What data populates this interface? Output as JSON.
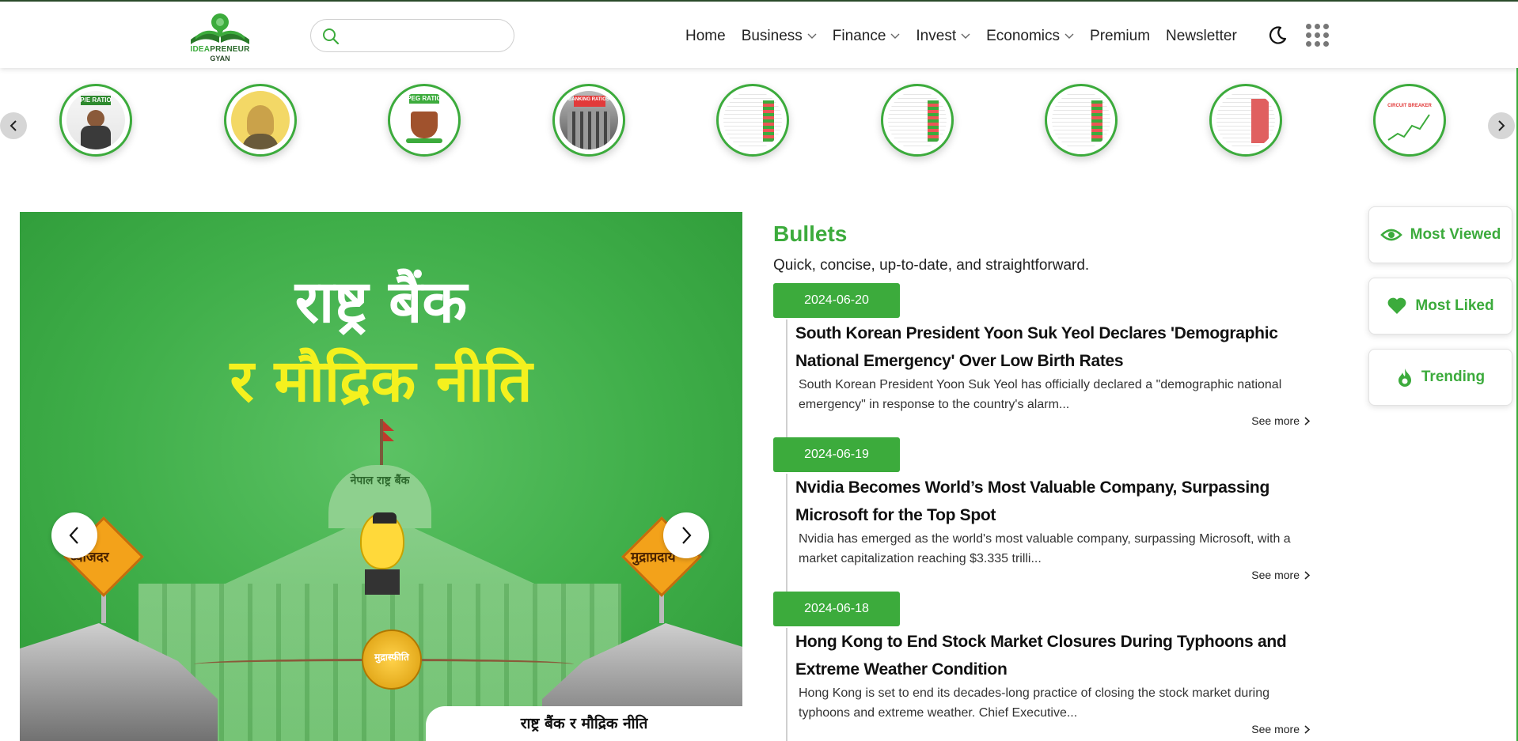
{
  "header": {
    "logo": {
      "line1_a": "IDEA",
      "line1_b": "PRENEUR",
      "line2": "GYAN"
    },
    "search": {
      "placeholder": "",
      "value": ""
    },
    "nav": [
      {
        "label": "Home",
        "dropdown": false
      },
      {
        "label": "Business",
        "dropdown": true
      },
      {
        "label": "Finance",
        "dropdown": true
      },
      {
        "label": "Invest",
        "dropdown": true
      },
      {
        "label": "Economics",
        "dropdown": true
      },
      {
        "label": "Premium",
        "dropdown": false
      },
      {
        "label": "Newsletter",
        "dropdown": false
      }
    ],
    "icons": {
      "theme_toggle": "moon-icon",
      "apps": "grid-dots-icon"
    }
  },
  "stories": [
    {
      "caption": "P/E RATIO",
      "theme": "photo"
    },
    {
      "caption": "",
      "theme": "yellow"
    },
    {
      "caption": "PEG RATIO",
      "theme": "chai"
    },
    {
      "caption": "BANKING RATIOS",
      "theme": "building"
    },
    {
      "caption": "",
      "theme": "table-green"
    },
    {
      "caption": "",
      "theme": "table-green"
    },
    {
      "caption": "",
      "theme": "table-green"
    },
    {
      "caption": "",
      "theme": "table-red"
    },
    {
      "caption": "CIRCUIT BREAKER",
      "theme": "chart"
    }
  ],
  "hero": {
    "title_line1": "राष्ट्र बैंक",
    "title_line2": "र मौद्रिक नीति",
    "sign_left": "ब्याजदर",
    "sign_right": "मुद्राप्रदाय",
    "coin_label": "मुद्रास्फीति",
    "building_label": "नेपाल राष्ट्र बैंक",
    "caption": "राष्ट्र बैंक र मौद्रिक नीति"
  },
  "bullets": {
    "title": "Bullets",
    "subtitle": "Quick, concise, up-to-date, and straightforward.",
    "see_more": "See more",
    "items": [
      {
        "date": "2024-06-20",
        "title": "South Korean President Yoon Suk Yeol Declares 'Demographic National Emergency' Over Low Birth Rates",
        "desc": "South Korean President Yoon Suk Yeol has officially declared a \"demographic national emergency\" in response to the country's alarm..."
      },
      {
        "date": "2024-06-19",
        "title": "Nvidia Becomes World’s Most Valuable Company, Surpassing Microsoft for the Top Spot",
        "desc": "Nvidia has emerged as the world's most valuable company, surpassing Microsoft, with a market capitalization reaching $3.335 trilli..."
      },
      {
        "date": "2024-06-18",
        "title": "Hong Kong to End Stock Market Closures During Typhoons and Extreme Weather Condition",
        "desc": "Hong Kong is set to end its decades-long practice of closing the stock market during typhoons and extreme weather. Chief Executive..."
      }
    ]
  },
  "side": [
    {
      "label": "Most Viewed",
      "icon": "eye-icon"
    },
    {
      "label": "Most Liked",
      "icon": "heart-icon"
    },
    {
      "label": "Trending",
      "icon": "flame-icon"
    }
  ],
  "colors": {
    "brand": "#3cab3c",
    "hero_yellow": "#f4f11e",
    "sign_orange": "#f3a21a"
  }
}
